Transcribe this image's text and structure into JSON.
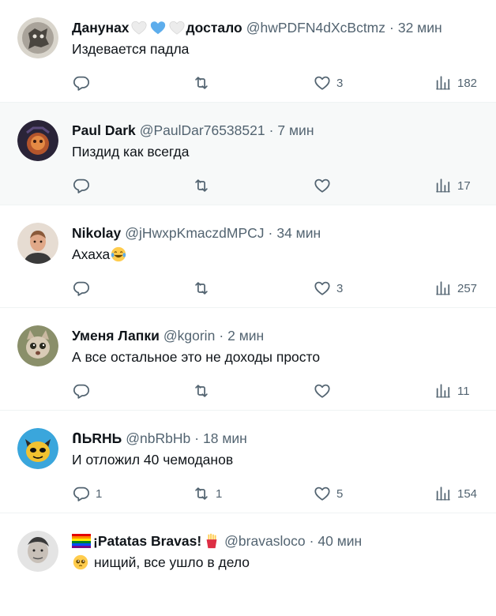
{
  "tweets": [
    {
      "name_prefix": "Данунах",
      "name_suffix": "достало",
      "name_emojis": [
        "white-heart",
        "blue-heart",
        "white-heart"
      ],
      "handle": "@hwPDFN4dXcBctmz",
      "time": "32 мин",
      "text": "Издевается падла",
      "replies": "",
      "retweets": "",
      "likes": "3",
      "views": "182"
    },
    {
      "name": "Paul Dark",
      "handle": "@PaulDar76538521",
      "time": "7 мин",
      "text": "Пиздид как всегда",
      "replies": "",
      "retweets": "",
      "likes": "",
      "views": "17"
    },
    {
      "name": "Nikolay",
      "handle": "@jHwxpKmaczdMPCJ",
      "time": "34 мин",
      "text": "Ахаха",
      "text_emoji": "tears-of-joy",
      "replies": "",
      "retweets": "",
      "likes": "3",
      "views": "257"
    },
    {
      "name": "Уменя Лапки",
      "handle": "@kgorin",
      "time": "2 мин",
      "text": "А все остальное это не доходы просто",
      "replies": "",
      "retweets": "",
      "likes": "",
      "views": "11"
    },
    {
      "name": "ՈЬRHЬ",
      "handle": "@nbRbHb",
      "time": "18 мин",
      "text": "И отложил 40 чемоданов",
      "replies": "1",
      "retweets": "1",
      "likes": "5",
      "views": "154"
    },
    {
      "name": "¡Patatas Bravas!",
      "name_emojis": [
        "rainbow-flag",
        "fries"
      ],
      "handle": "@bravasloco",
      "time": "40 мин",
      "text": "нищий, все ушло в дело",
      "text_emoji": "pleading-face",
      "replies": "",
      "retweets": "",
      "likes": "",
      "views": ""
    }
  ],
  "colors": {
    "text": "#0f1419",
    "secondary": "#536471",
    "border": "#eff3f4",
    "highlight_bg": "#f7f9f9"
  },
  "icons": [
    "reply-icon",
    "retweet-icon",
    "like-icon",
    "views-icon"
  ]
}
